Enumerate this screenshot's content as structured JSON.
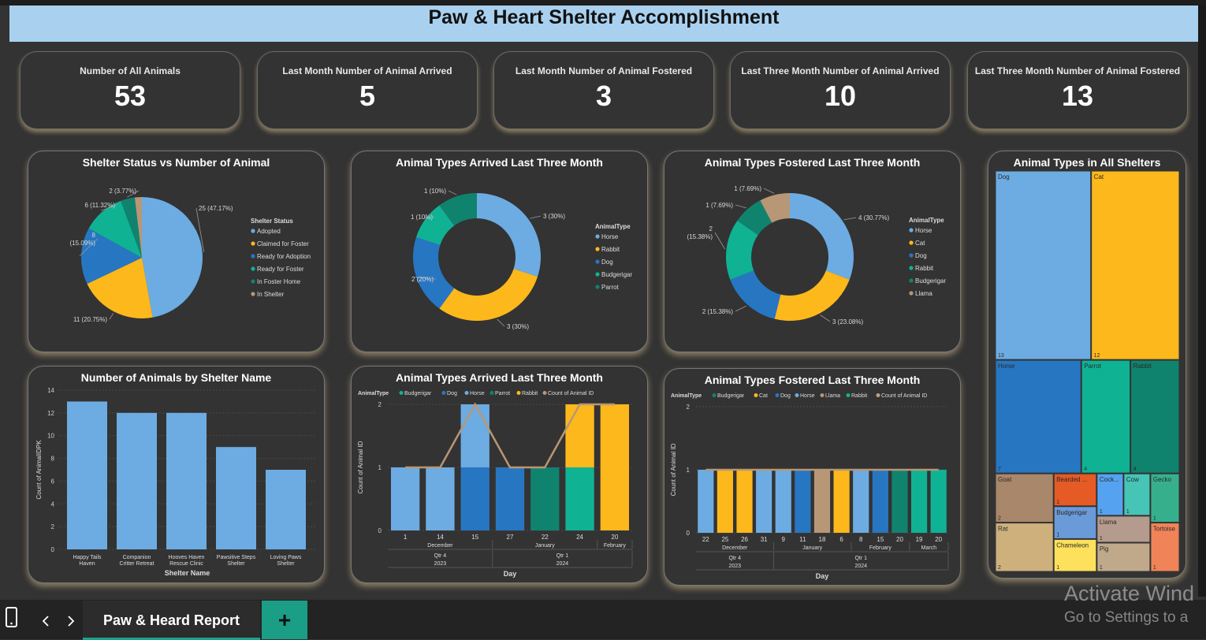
{
  "header": {
    "title": "Paw & Heart Shelter Accomplishment"
  },
  "kpis": [
    {
      "label": "Number of All Animals",
      "value": "53"
    },
    {
      "label": "Last Month Number of Animal Arrived",
      "value": "5"
    },
    {
      "label": "Last Month Number of Animal Fostered",
      "value": "3"
    },
    {
      "label": "Last Three Month Number of Animal Arrived",
      "value": "10"
    },
    {
      "label": "Last Three Month Number of Animal Fostered",
      "value": "13"
    }
  ],
  "titles": {
    "status_pie": "Shelter Status vs Number of Animal",
    "arrived_donut": "Animal Types Arrived Last Three Month",
    "fostered_donut": "Animal Types Fostered Last Three Month",
    "treemap": "Animal Types in All Shelters",
    "shelter_bar": "Number of Animals by Shelter Name",
    "arrived_bar": "Animal Types Arrived Last Three Month",
    "fostered_bar": "Animal Types Fostered Last Three Month"
  },
  "colors": {
    "light_blue": "#6cace2",
    "yellow": "#fdb81c",
    "blue": "#2776c2",
    "green": "#10b294",
    "dark_green": "#10836f",
    "tan": "#b79775",
    "line": "#c0a27c"
  },
  "chart_data": [
    {
      "type": "pie",
      "legend_title": "Shelter Status",
      "categories": [
        "Adopted",
        "Claimed for Foster",
        "Ready for Adoption",
        "Ready for Foster",
        "In Foster Home",
        "In Shelter"
      ],
      "values": [
        25,
        11,
        8,
        6,
        2,
        1
      ],
      "labels": [
        "25 (47.17%)",
        "11 (20.75%)",
        "8 (15.09%)",
        "6 (11.32%)",
        "2 (3.77%)",
        ""
      ],
      "colors": [
        "#6cace2",
        "#fdb81c",
        "#2776c2",
        "#10b294",
        "#10836f",
        "#b79775"
      ]
    },
    {
      "type": "pie",
      "subtype": "donut",
      "legend_title": "AnimalType",
      "categories": [
        "Horse",
        "Rabbit",
        "Dog",
        "Budgerigar",
        "Parrot"
      ],
      "values": [
        3,
        3,
        2,
        1,
        1
      ],
      "labels": [
        "3 (30%)",
        "3 (30%)",
        "2 (20%)",
        "1 (10%)",
        "1 (10%)"
      ],
      "colors": [
        "#6cace2",
        "#fdb81c",
        "#2776c2",
        "#10b294",
        "#10836f"
      ]
    },
    {
      "type": "pie",
      "subtype": "donut",
      "legend_title": "AnimalType",
      "categories": [
        "Horse",
        "Cat",
        "Dog",
        "Rabbit",
        "Budgerigar",
        "Llama"
      ],
      "values": [
        4,
        3,
        2,
        2,
        1,
        1
      ],
      "labels": [
        "4 (30.77%)",
        "3 (23.08%)",
        "2 (15.38%)",
        "2 (15.38%)",
        "1 (7.69%)",
        "1 (7.69%)"
      ],
      "colors": [
        "#6cace2",
        "#fdb81c",
        "#2776c2",
        "#10b294",
        "#10836f",
        "#b79775"
      ]
    },
    {
      "type": "treemap",
      "items": [
        {
          "name": "Dog",
          "value": 13,
          "label": "13",
          "color": "#6cace2"
        },
        {
          "name": "Cat",
          "value": 12,
          "label": "12",
          "color": "#fdb81c"
        },
        {
          "name": "Horse",
          "value": 7,
          "label": "7",
          "color": "#2776c2"
        },
        {
          "name": "Parrot",
          "value": 4,
          "label": "4",
          "color": "#10b294"
        },
        {
          "name": "Rabbit",
          "value": 4,
          "label": "4",
          "color": "#10836f"
        },
        {
          "name": "Goat",
          "value": 2,
          "label": "2",
          "color": "#a8876a"
        },
        {
          "name": "Bearded ...",
          "value": 1,
          "label": "1",
          "color": "#e55a25"
        },
        {
          "name": "Budgerigar",
          "value": 1,
          "label": "1",
          "color": "#6b9ad8"
        },
        {
          "name": "Chameleon",
          "value": 1,
          "label": "1",
          "color": "#fde05c"
        },
        {
          "name": "Cock...",
          "value": 1,
          "label": "1",
          "color": "#55a3f0"
        },
        {
          "name": "Cow",
          "value": 1,
          "label": "1",
          "color": "#46c4b6"
        },
        {
          "name": "Gecko",
          "value": 1,
          "label": "1",
          "color": "#36b08c"
        },
        {
          "name": "Llama",
          "value": 1,
          "label": "1",
          "color": "#b59a8e"
        },
        {
          "name": "Pig",
          "value": 1,
          "label": "1",
          "color": "#bfa98a"
        },
        {
          "name": "Rat",
          "value": 2,
          "label": "2",
          "color": "#cdb07c"
        },
        {
          "name": "Tortoise",
          "value": 1,
          "label": "1",
          "color": "#f08458"
        }
      ]
    },
    {
      "type": "bar",
      "xlabel": "Shelter Name",
      "ylabel": "Count of AnimalIDPK",
      "categories": [
        [
          "Happy Tails",
          "Haven"
        ],
        [
          "Companion",
          "Critter Retreat"
        ],
        [
          "Hooves Haven",
          "Rescue Clinic"
        ],
        [
          "Pawsitive Steps",
          "Shelter"
        ],
        [
          "Loving Paws",
          "Shelter"
        ]
      ],
      "values": [
        13,
        12,
        12,
        9,
        7
      ],
      "ylim": [
        0,
        14
      ],
      "yticks": [
        0,
        2,
        4,
        6,
        8,
        10,
        12,
        14
      ],
      "color": "#6cace2"
    },
    {
      "type": "bar",
      "subtype": "stacked+line",
      "legend_title": "AnimalType",
      "legend": [
        {
          "name": "Budgerigar",
          "color": "#10b294"
        },
        {
          "name": "Dog",
          "color": "#2776c2"
        },
        {
          "name": "Horse",
          "color": "#6cace2"
        },
        {
          "name": "Parrot",
          "color": "#10836f"
        },
        {
          "name": "Rabbit",
          "color": "#fdb81c"
        },
        {
          "name": "Count of Animal ID",
          "color": "#b79775"
        }
      ],
      "ylabel": "Count of Animal ID",
      "xlabel": "Day",
      "ylim": [
        0,
        2
      ],
      "yticks": [
        0,
        1,
        2
      ],
      "x": [
        "1",
        "14",
        "15",
        "27",
        "22",
        "24",
        "20"
      ],
      "stacks": [
        [
          {
            "c": "#6cace2",
            "v": 1
          }
        ],
        [
          {
            "c": "#6cace2",
            "v": 1
          }
        ],
        [
          {
            "c": "#2776c2",
            "v": 1
          },
          {
            "c": "#6cace2",
            "v": 1
          }
        ],
        [
          {
            "c": "#2776c2",
            "v": 1
          }
        ],
        [
          {
            "c": "#10836f",
            "v": 1
          }
        ],
        [
          {
            "c": "#10b294",
            "v": 1
          },
          {
            "c": "#fdb81c",
            "v": 1
          }
        ],
        [
          {
            "c": "#fdb81c",
            "v": 2
          }
        ]
      ],
      "line": [
        1,
        1,
        2,
        1,
        1,
        2,
        2
      ],
      "months": [
        {
          "label": "December",
          "span": [
            0,
            2
          ]
        },
        {
          "label": "January",
          "span": [
            3,
            5
          ]
        },
        {
          "label": "February",
          "span": [
            6,
            6
          ]
        }
      ],
      "quarters": [
        {
          "label": "Qtr 4",
          "span": [
            0,
            2
          ]
        },
        {
          "label": "Qtr 1",
          "span": [
            3,
            6
          ]
        }
      ],
      "years": [
        {
          "label": "2023",
          "span": [
            0,
            2
          ]
        },
        {
          "label": "2024",
          "span": [
            3,
            6
          ]
        }
      ]
    },
    {
      "type": "bar",
      "subtype": "stacked+line",
      "legend_title": "AnimalType",
      "legend": [
        {
          "name": "Budgerigar",
          "color": "#10836f"
        },
        {
          "name": "Cat",
          "color": "#fdb81c"
        },
        {
          "name": "Dog",
          "color": "#2776c2"
        },
        {
          "name": "Horse",
          "color": "#6cace2"
        },
        {
          "name": "Llama",
          "color": "#b79775"
        },
        {
          "name": "Rabbit",
          "color": "#10b294"
        },
        {
          "name": "Count of Animal ID",
          "color": "#c0a27c"
        }
      ],
      "ylabel": "Count of Animal ID",
      "xlabel": "Day",
      "ylim": [
        0,
        2
      ],
      "yticks": [
        0,
        1,
        2
      ],
      "x": [
        "22",
        "25",
        "26",
        "31",
        "9",
        "11",
        "18",
        "6",
        "8",
        "15",
        "20",
        "19",
        "20"
      ],
      "stacks": [
        [
          {
            "c": "#6cace2",
            "v": 1
          }
        ],
        [
          {
            "c": "#fdb81c",
            "v": 1
          }
        ],
        [
          {
            "c": "#fdb81c",
            "v": 1
          }
        ],
        [
          {
            "c": "#6cace2",
            "v": 1
          }
        ],
        [
          {
            "c": "#6cace2",
            "v": 1
          }
        ],
        [
          {
            "c": "#2776c2",
            "v": 1
          }
        ],
        [
          {
            "c": "#b79775",
            "v": 1
          }
        ],
        [
          {
            "c": "#fdb81c",
            "v": 1
          }
        ],
        [
          {
            "c": "#6cace2",
            "v": 1
          }
        ],
        [
          {
            "c": "#2776c2",
            "v": 1
          }
        ],
        [
          {
            "c": "#10836f",
            "v": 1
          }
        ],
        [
          {
            "c": "#10b294",
            "v": 1
          }
        ],
        [
          {
            "c": "#10b294",
            "v": 1
          }
        ]
      ],
      "line": [
        1,
        1,
        1,
        1,
        1,
        1,
        1,
        1,
        1,
        1,
        1,
        1,
        1
      ],
      "months": [
        {
          "label": "December",
          "span": [
            0,
            3
          ]
        },
        {
          "label": "January",
          "span": [
            4,
            7
          ]
        },
        {
          "label": "February",
          "span": [
            8,
            10
          ]
        },
        {
          "label": "March",
          "span": [
            11,
            12
          ]
        }
      ],
      "quarters": [
        {
          "label": "Qtr 4",
          "span": [
            0,
            3
          ]
        },
        {
          "label": "Qtr 1",
          "span": [
            4,
            12
          ]
        }
      ],
      "years": [
        {
          "label": "2023",
          "span": [
            0,
            3
          ]
        },
        {
          "label": "2024",
          "span": [
            4,
            12
          ]
        }
      ]
    }
  ],
  "footer": {
    "tab_label": "Paw & Heard Report",
    "add_label": "+"
  },
  "watermark": {
    "line1": "Activate Wind",
    "line2": "Go to Settings to a"
  }
}
